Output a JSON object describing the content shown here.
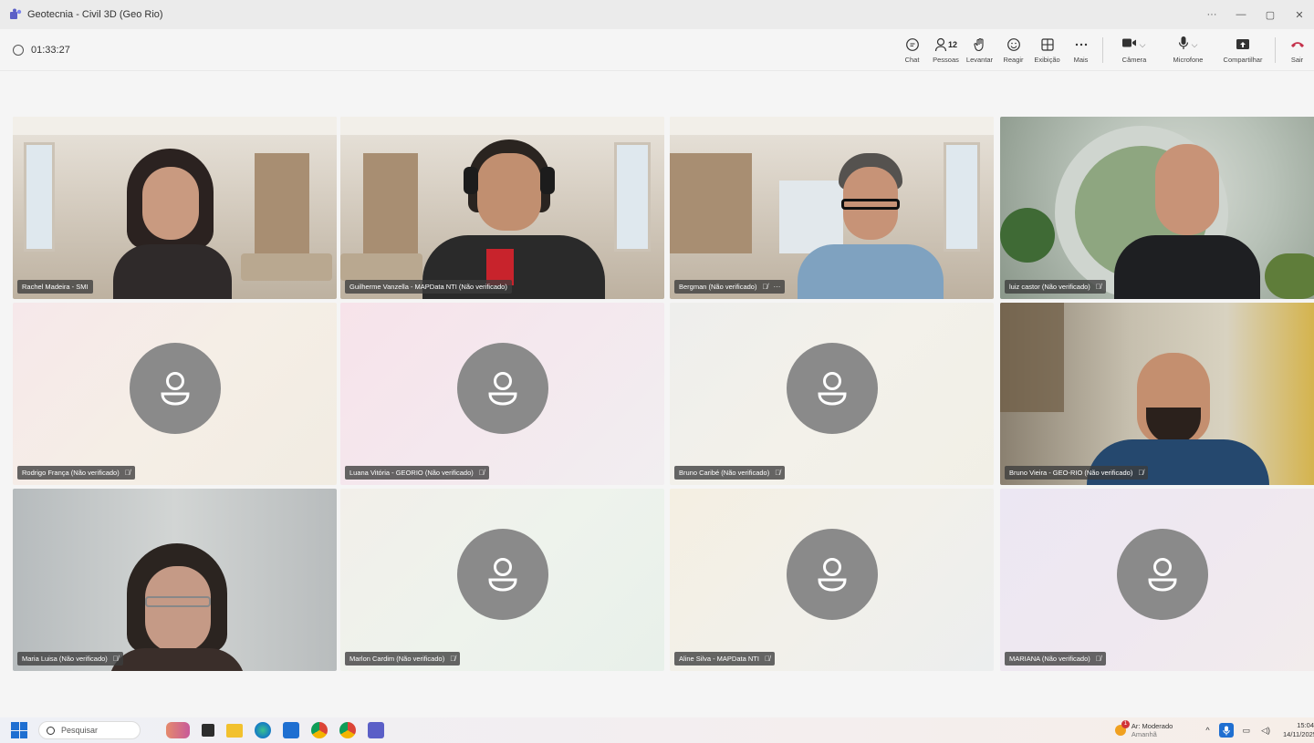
{
  "window": {
    "title": "Geotecnia - Civil 3D (Geo Rio)",
    "controls": [
      "···",
      "—",
      "▢",
      "✕"
    ]
  },
  "meeting": {
    "timer": "01:33:27"
  },
  "toolbar": {
    "chat_label": "Chat",
    "people_label": "Pessoas",
    "people_count": "12",
    "raise_label": "Levantar",
    "react_label": "Reagir",
    "view_label": "Exibição",
    "more_label": "Mais",
    "camera_label": "Câmera",
    "mic_label": "Microfone",
    "share_label": "Compartilhar",
    "leave_label": "Sair",
    "leave_color": "#c4314b"
  },
  "participants": [
    {
      "name": "Rachel Madeira - SMI",
      "video": true,
      "muted": false
    },
    {
      "name": "Guilherme Vanzella - MAPData NTI (Não verificado)",
      "video": true,
      "muted": false
    },
    {
      "name": "Bergman (Não verificado)",
      "video": true,
      "muted": true,
      "more": "···"
    },
    {
      "name": "luiz castor (Não verificado)",
      "video": true,
      "muted": true
    },
    {
      "name": "Rodrigo França (Não verificado)",
      "video": false,
      "muted": true
    },
    {
      "name": "Luana Vitória - GEORIO (Não verificado)",
      "video": false,
      "muted": true
    },
    {
      "name": "Bruno Caribé (Não verificado)",
      "video": false,
      "muted": true
    },
    {
      "name": "Bruno Vieira - GEO-RIO (Não verificado)",
      "video": true,
      "muted": true
    },
    {
      "name": "Maria Luisa (Não verificado)",
      "video": true,
      "muted": true
    },
    {
      "name": "Marlon Cardim (Não verificado)",
      "video": false,
      "muted": true
    },
    {
      "name": "Aline Silva - MAPData NTI",
      "video": false,
      "muted": true
    },
    {
      "name": "MARIANA (Não verificado)",
      "video": false,
      "muted": true
    }
  ],
  "taskbar": {
    "search_placeholder": "Pesquisar",
    "weather_title": "Ar: Moderado",
    "weather_sub": "Amanhã",
    "weather_badge": "1",
    "time": "15:04",
    "date": "14/11/2025",
    "accent": "#1f6fd1"
  }
}
